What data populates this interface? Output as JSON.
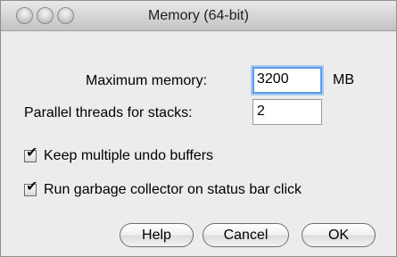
{
  "window": {
    "title": "Memory (64-bit)"
  },
  "form": {
    "max_memory_label": "Maximum memory:",
    "max_memory_value": "3200",
    "max_memory_unit": "MB",
    "threads_label": "Parallel threads for stacks:",
    "threads_value": "2"
  },
  "options": [
    {
      "label": "Keep multiple undo buffers",
      "checked": true
    },
    {
      "label": "Run garbage collector on status bar click",
      "checked": true
    }
  ],
  "buttons": {
    "help": "Help",
    "cancel": "Cancel",
    "ok": "OK"
  },
  "check_glyph": "✔"
}
